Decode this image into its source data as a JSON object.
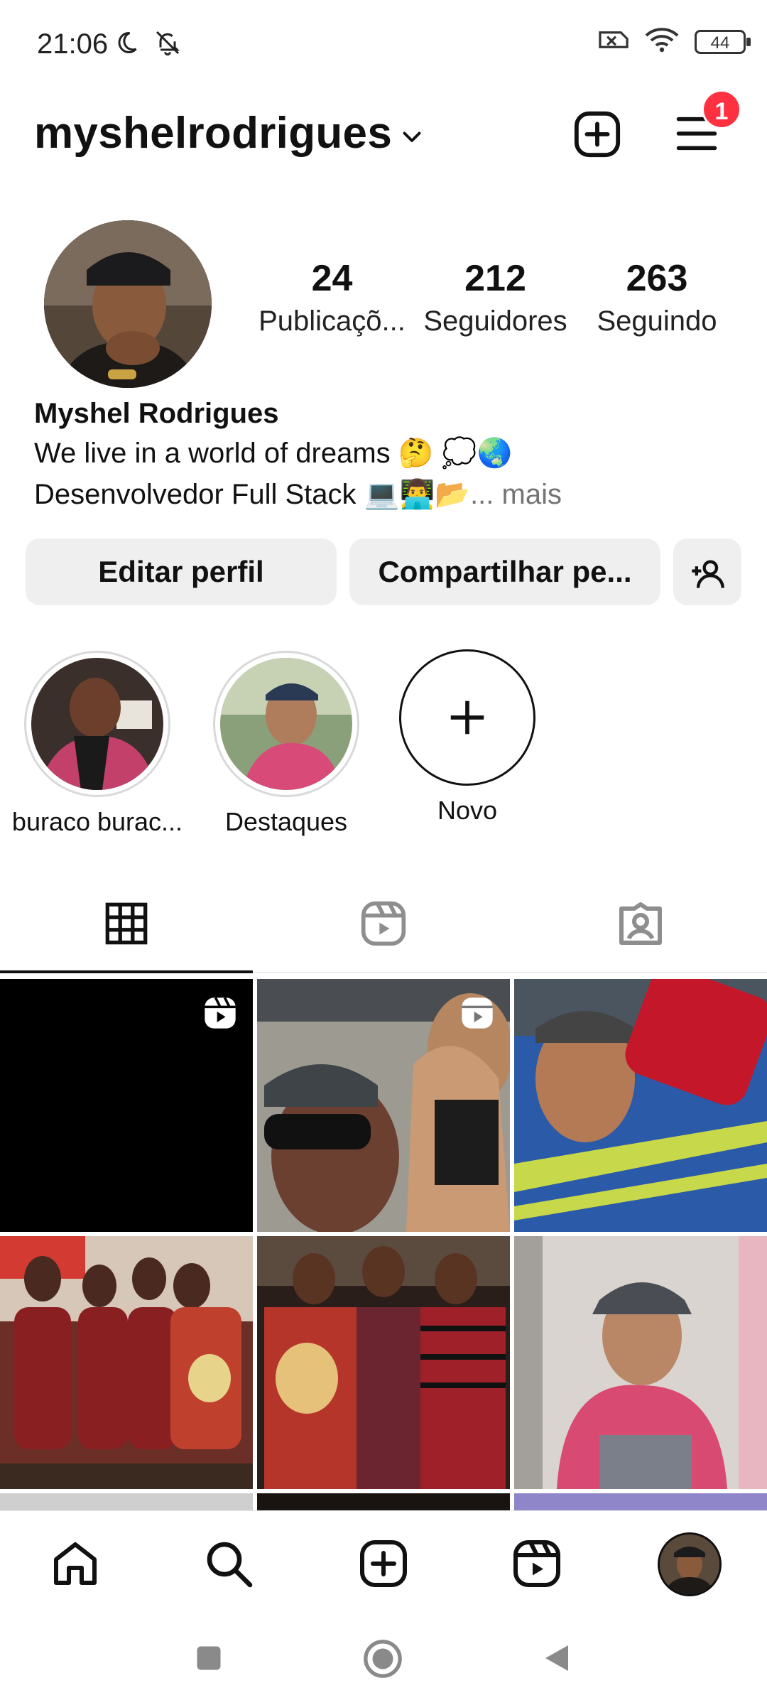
{
  "status_bar": {
    "time": "21:06",
    "battery": "44"
  },
  "header": {
    "username": "myshelrodrigues",
    "notification_count": "1"
  },
  "profile": {
    "stats": [
      {
        "value": "24",
        "label": "Publicaçõ..."
      },
      {
        "value": "212",
        "label": "Seguidores"
      },
      {
        "value": "263",
        "label": "Seguindo"
      }
    ],
    "name": "Myshel Rodrigues",
    "bio_line1": "We live in a world of dreams 🤔 💭🌏",
    "bio_line2": " Desenvolvedor Full Stack 💻👨‍💻📂",
    "bio_more": "... mais"
  },
  "actions": {
    "edit_label": "Editar perfil",
    "share_label": "Compartilhar pe..."
  },
  "highlights": [
    {
      "label": "buraco burac..."
    },
    {
      "label": "Destaques"
    },
    {
      "label": "Novo"
    }
  ],
  "icons": {
    "tabs": [
      "grid-icon",
      "reels-icon",
      "tagged-icon"
    ],
    "bottom_nav": [
      "home-icon",
      "search-icon",
      "create-icon",
      "reels-icon",
      "profile-avatar"
    ]
  },
  "colors": {
    "badge": "#ff3040",
    "button_bg": "#efefef",
    "muted_text": "#737373"
  }
}
